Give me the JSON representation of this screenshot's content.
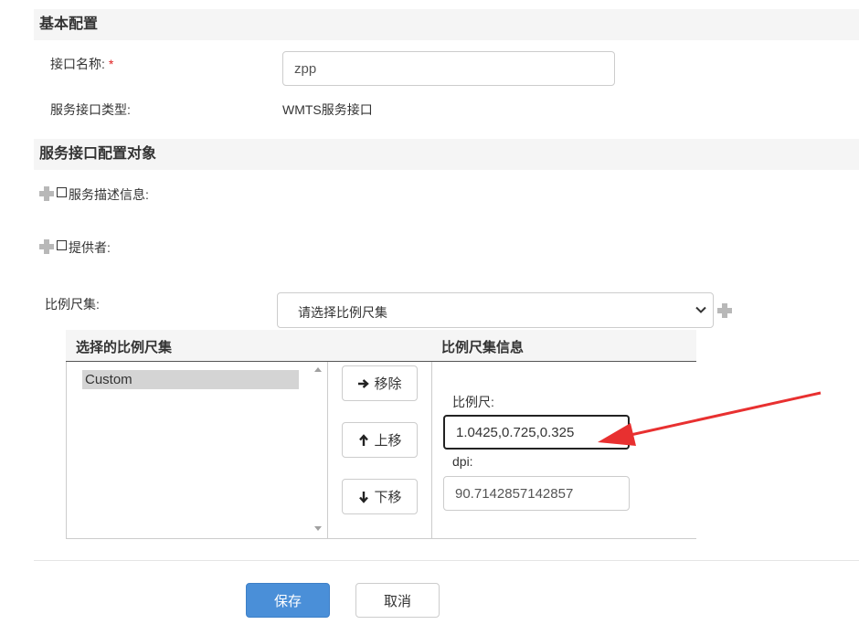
{
  "basic": {
    "header": "基本配置",
    "name_label": "接口名称:",
    "required_mark": "*",
    "name_value": "zpp",
    "type_label": "服务接口类型:",
    "type_value": "WMTS服务接口"
  },
  "config": {
    "header": "服务接口配置对象",
    "desc_label": "服务描述信息:",
    "provider_label": "提供者:",
    "scale_set_label": "比例尺集:",
    "scale_set_placeholder": "请选择比例尺集"
  },
  "scale_panel": {
    "selected_header": "选择的比例尺集",
    "info_header": "比例尺集信息",
    "items": [
      "Custom"
    ],
    "remove_label": "移除",
    "up_label": "上移",
    "down_label": "下移",
    "scale_label": "比例尺:",
    "scale_value": "1.0425,0.725,0.325",
    "dpi_label": "dpi:",
    "dpi_value": "90.7142857142857"
  },
  "actions": {
    "save_label": "保存",
    "cancel_label": "取消"
  },
  "colors": {
    "primary": "#4a8fd8",
    "required": "#e02020",
    "annotation": "#e83030"
  }
}
